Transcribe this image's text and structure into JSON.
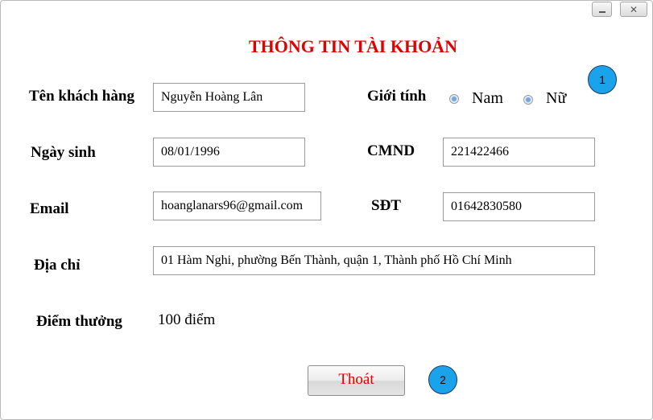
{
  "window": {
    "minimize_glyph": "",
    "close_glyph": "✕"
  },
  "title": "THÔNG TIN TÀI KHOẢN",
  "form": {
    "name_label": "Tên khách hàng",
    "name_value": "Nguyễn Hoàng Lân",
    "gender_label": "Giới tính",
    "gender_options": [
      "Nam",
      "Nữ"
    ],
    "dob_label": "Ngày sinh",
    "dob_value": "08/01/1996",
    "id_label": "CMND",
    "id_value": "221422466",
    "email_label": "Email",
    "email_value": "hoanglanars96@gmail.com",
    "phone_label": "SĐT",
    "phone_value": "01642830580",
    "address_label": "Địa chỉ",
    "address_value": "01 Hàm Nghi, phường Bến Thành, quận 1, Thành phố Hồ Chí Minh",
    "points_label": "Điểm thưởng",
    "points_value": "100 điểm"
  },
  "exit_button_label": "Thoát",
  "badges": [
    "1",
    "2"
  ],
  "colors": {
    "title": "#e00000",
    "exit_text": "#e00000",
    "badge_fill": "#1aa3ea"
  }
}
